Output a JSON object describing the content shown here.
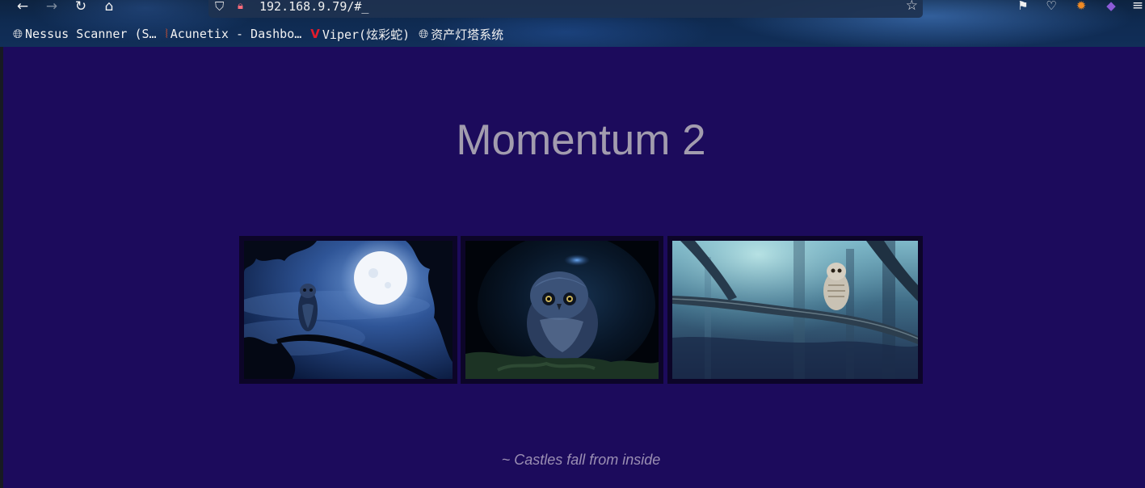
{
  "browser": {
    "url": "192.168.9.79/#_",
    "nav": {
      "back_icon": "←",
      "forward_icon": "→",
      "reload_icon": "↻",
      "home_icon": "⌂"
    },
    "url_icons": {
      "shield_icon": "⛉",
      "page_icon": "🔒︎"
    },
    "star_icon": "☆",
    "toolbar_icons": {
      "extensions_icon": "⚑",
      "pocket_icon": "♡",
      "extension_orange_icon": "✹",
      "extension_purple_icon": "◆",
      "menu_icon": "≡"
    },
    "bookmarks": [
      {
        "icon": "🌐︎",
        "label": "Nessus Scanner (S…",
        "icon_color": "#ffffff"
      },
      {
        "icon": "⦚",
        "label": "Acunetix - Dashbo…",
        "icon_color": "#e0542e"
      },
      {
        "icon": "V",
        "label": "Viper(炫彩蛇)",
        "icon_color": "#e21b2b"
      },
      {
        "icon": "🌐︎",
        "label": "资产灯塔系统",
        "icon_color": "#ffffff"
      }
    ]
  },
  "page": {
    "title": "Momentum 2",
    "footer": "~ Castles fall from inside",
    "background_color": "#1c0b5c",
    "images": [
      {
        "subject": "owl on branch under full moon"
      },
      {
        "subject": "owl in dark tree hollow"
      },
      {
        "subject": "barred owl on forest branch"
      }
    ]
  }
}
